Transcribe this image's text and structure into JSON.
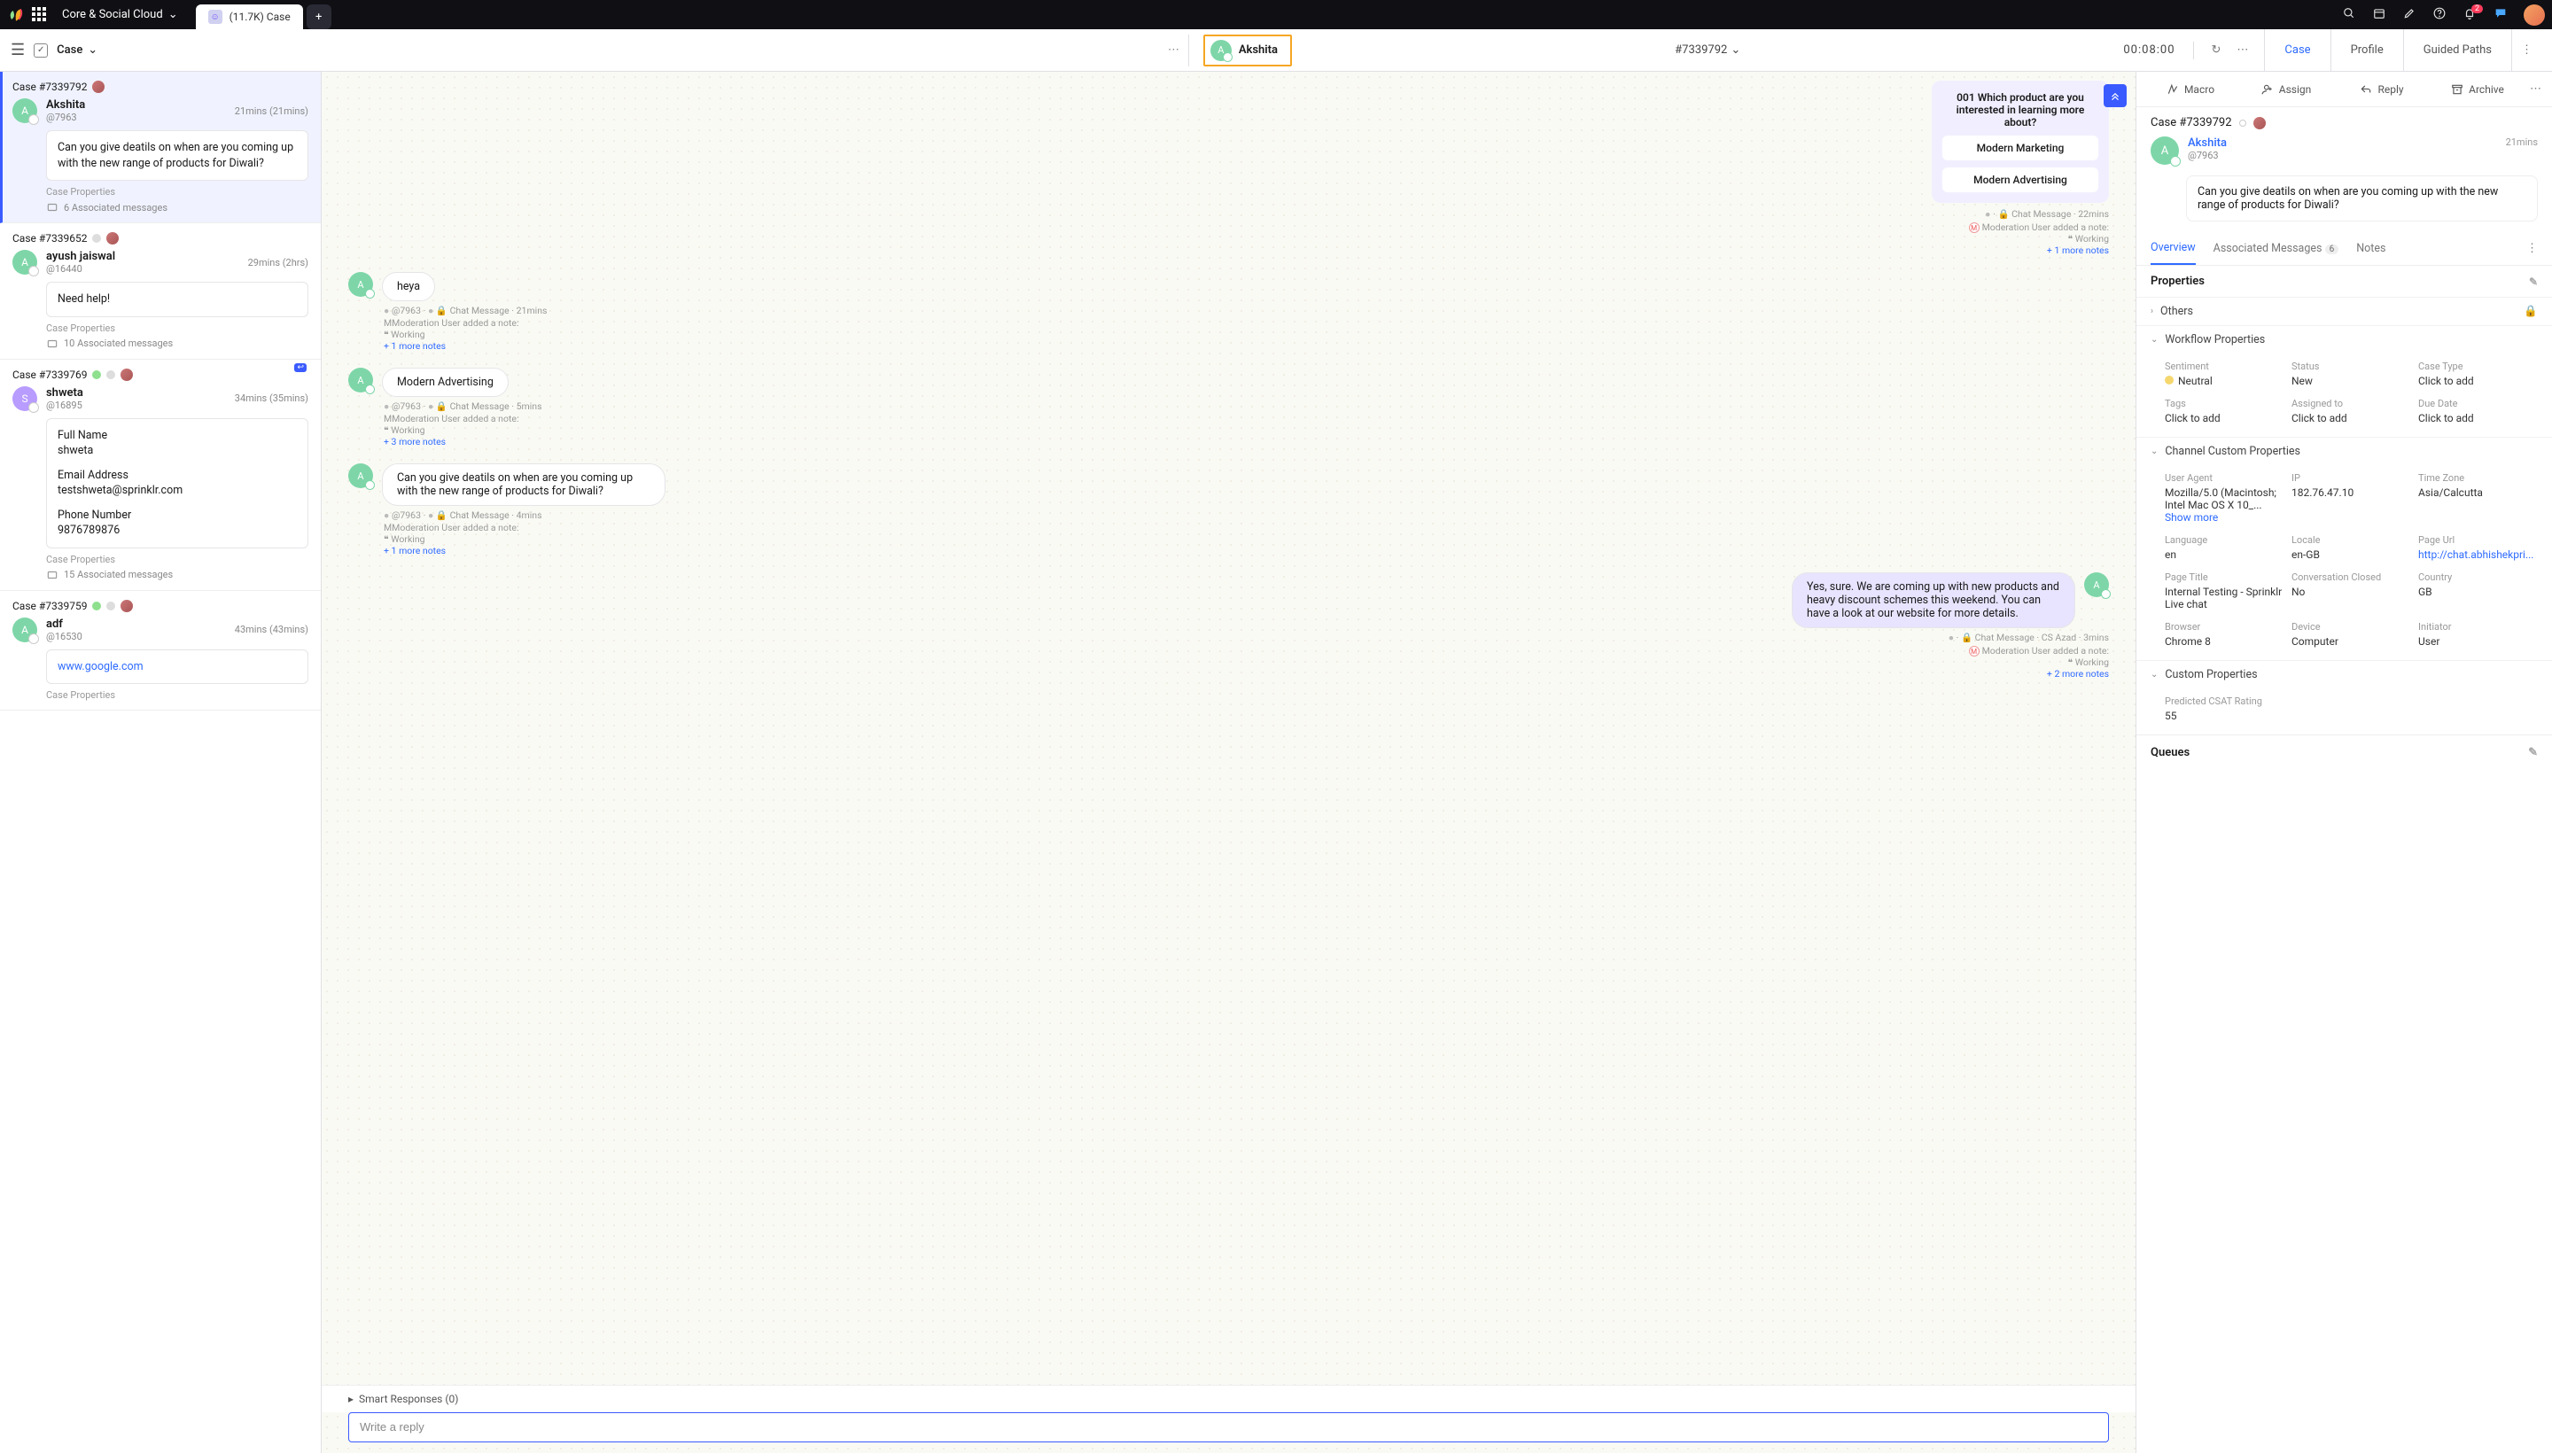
{
  "topbar": {
    "workspace": "Core & Social Cloud",
    "tab_label": "(11.7K) Case",
    "notif_count": "2"
  },
  "bar2": {
    "case_dd": "Case"
  },
  "conv_header": {
    "customer": "Akshita",
    "case_no": "#7339792",
    "timer": "00:08:00"
  },
  "right_tabs": {
    "case": "Case",
    "profile": "Profile",
    "guided": "Guided Paths"
  },
  "left": [
    {
      "case": "Case #7339792",
      "name": "Akshita",
      "handle": "@7963",
      "time": "21mins  (21mins)",
      "avbg": "#7ed6a8",
      "avch": "A",
      "text": "Can you give deatils on when are you coming up with the new range of products for Diwali?",
      "props": "Case Properties",
      "assoc": "6 Associated messages",
      "dots": []
    },
    {
      "case": "Case #7339652",
      "name": "ayush jaiswal",
      "handle": "@16440",
      "time": "29mins  (2hrs)",
      "avbg": "#7ed6a8",
      "avch": "A",
      "text": "Need help!",
      "props": "Case Properties",
      "assoc": "10 Associated messages",
      "dots": [
        "#ddd"
      ]
    },
    {
      "case": "Case #7339769",
      "name": "shweta",
      "handle": "@16895",
      "time": "34mins  (35mins)",
      "avbg": "#b89cff",
      "avch": "S",
      "fields": [
        {
          "l": "Full Name",
          "v": "shweta"
        },
        {
          "l": "Email Address",
          "v": "testshweta@sprinklr.com"
        },
        {
          "l": "Phone Number",
          "v": "9876789876"
        }
      ],
      "props": "Case Properties",
      "assoc": "15 Associated messages",
      "dots": [
        "#8ee08e",
        "#ddd"
      ]
    },
    {
      "case": "Case #7339759",
      "name": "adf",
      "handle": "@16530",
      "time": "43mins  (43mins)",
      "avbg": "#7ed6a8",
      "avch": "A",
      "link": "www.google.com",
      "props": "Case Properties",
      "dots": [
        "#8ee08e",
        "#ddd"
      ]
    }
  ],
  "conv": {
    "prompt": {
      "title": "001 Which product are you interested in learning more about?",
      "opts": [
        "Modern Marketing",
        "Modern Advertising"
      ],
      "meta": "Chat Message  ·  22mins",
      "note": "Moderation User added a note:",
      "working": "Working",
      "more": "+ 1 more notes"
    },
    "msgs": [
      {
        "dir": "in",
        "text": "heya",
        "meta": "@7963  ·     Chat Message  ·  21mins",
        "note": "Moderation User added a note:",
        "working": "Working",
        "more": "+ 1 more notes"
      },
      {
        "dir": "in",
        "text": "Modern Advertising",
        "meta": "@7963  ·     Chat Message  ·  5mins",
        "note": "Moderation User added a note:",
        "working": "Working",
        "more": "+ 3 more notes"
      },
      {
        "dir": "in",
        "text": "Can you give deatils on when are you coming up with the new range of products for Diwali?",
        "meta": "@7963  ·     Chat Message  ·  4mins",
        "note": "Moderation User added a note:",
        "working": "Working",
        "more": "+ 1 more notes"
      },
      {
        "dir": "out",
        "text": "Yes, sure. We are coming up with new products and heavy discount schemes this weekend. You can have a look at our website for more details.",
        "meta": "Chat Message  ·  CS Azad  ·  3mins",
        "note": "Moderation User added a note:",
        "working": "Working",
        "more": "+ 2 more notes"
      }
    ],
    "smart": "Smart Responses (0)",
    "reply_ph": "Write a reply"
  },
  "ractions": {
    "macro": "Macro",
    "assign": "Assign",
    "reply": "Reply",
    "archive": "Archive"
  },
  "rpanel": {
    "case": "Case #7339792",
    "name": "Akshita",
    "handle": "@7963",
    "time": "21mins",
    "text": "Can you give deatils on when are you coming up with the new range of products for Diwali?",
    "tabs": {
      "overview": "Overview",
      "assoc": "Associated Messages",
      "assoc_n": "6",
      "notes": "Notes"
    },
    "properties": "Properties",
    "others": "Others",
    "wf": "Workflow Properties",
    "wf_props": [
      {
        "l": "Sentiment",
        "v": "Neutral",
        "sent": true
      },
      {
        "l": "Status",
        "v": "New"
      },
      {
        "l": "Case Type",
        "v": "Click to add"
      },
      {
        "l": "Tags",
        "v": "Click to add"
      },
      {
        "l": "Assigned to",
        "v": "Click to add"
      },
      {
        "l": "Due Date",
        "v": "Click to add"
      }
    ],
    "ch": "Channel Custom Properties",
    "ch_props": [
      {
        "l": "User Agent",
        "v": "Mozilla/5.0 (Macintosh; Intel Mac OS X 10_...",
        "more": "Show more"
      },
      {
        "l": "IP",
        "v": "182.76.47.10"
      },
      {
        "l": "Time Zone",
        "v": "Asia/Calcutta"
      },
      {
        "l": "Language",
        "v": "en"
      },
      {
        "l": "Locale",
        "v": "en-GB"
      },
      {
        "l": "Page Url",
        "v": "http://chat.abhishekpri...",
        "link": true
      },
      {
        "l": "Page Title",
        "v": "Internal Testing - Sprinklr Live chat"
      },
      {
        "l": "Conversation Closed",
        "v": "No"
      },
      {
        "l": "Country",
        "v": "GB"
      },
      {
        "l": "Browser",
        "v": "Chrome 8"
      },
      {
        "l": "Device",
        "v": "Computer"
      },
      {
        "l": "Initiator",
        "v": "User"
      }
    ],
    "cu": "Custom Properties",
    "cu_props": [
      {
        "l": "Predicted CSAT Rating",
        "v": "55"
      }
    ],
    "queues": "Queues"
  }
}
